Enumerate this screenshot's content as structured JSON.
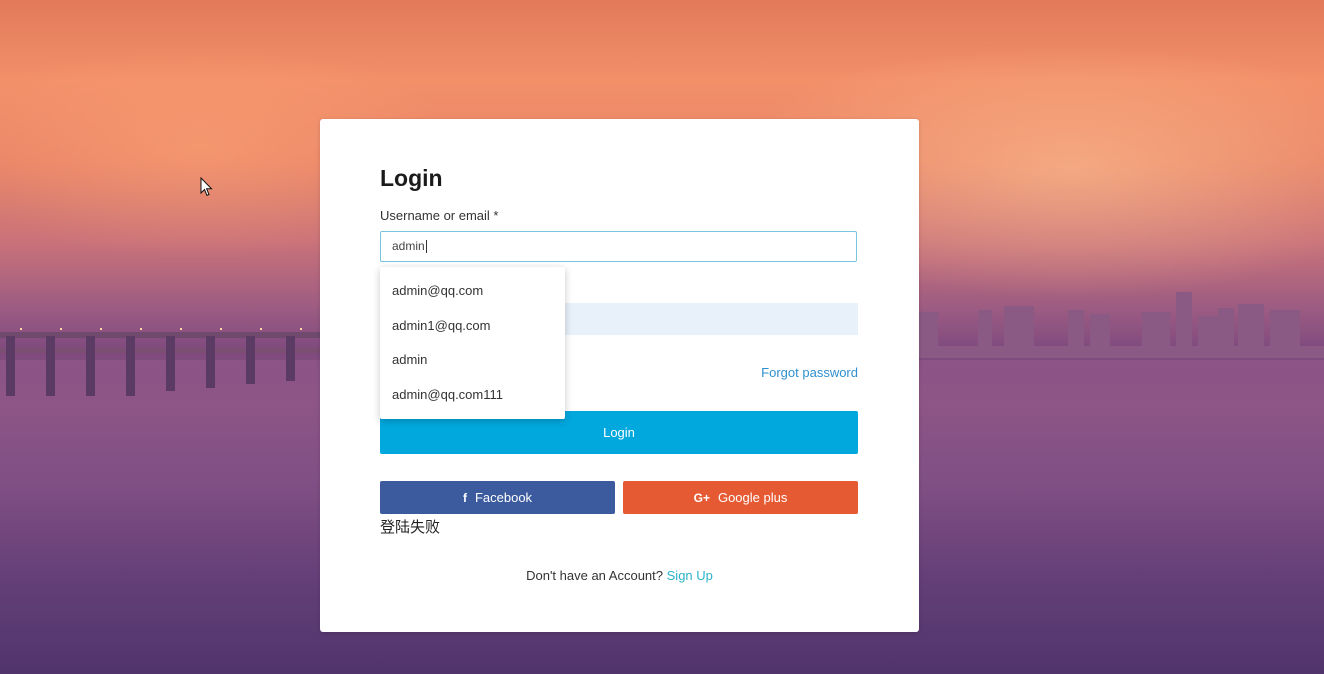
{
  "login": {
    "title": "Login",
    "username_label": "Username or email *",
    "username_value": "admin",
    "forgot_password": "Forgot password",
    "login_button": "Login",
    "facebook_icon": "f",
    "facebook_label": "Facebook",
    "google_icon": "G+",
    "google_label": "Google plus",
    "error_message": "登陆失败",
    "no_account_text": "Don't have an Account?",
    "signup_link": "Sign Up"
  },
  "autocomplete": {
    "options": [
      "admin@qq.com",
      "admin1@qq.com",
      "admin",
      "admin@qq.com111"
    ]
  },
  "colors": {
    "login_button": "#00a8de",
    "facebook": "#3b5b9e",
    "google": "#e65a33",
    "link": "#2f8fcf",
    "signup_link": "#2bb3c9"
  }
}
